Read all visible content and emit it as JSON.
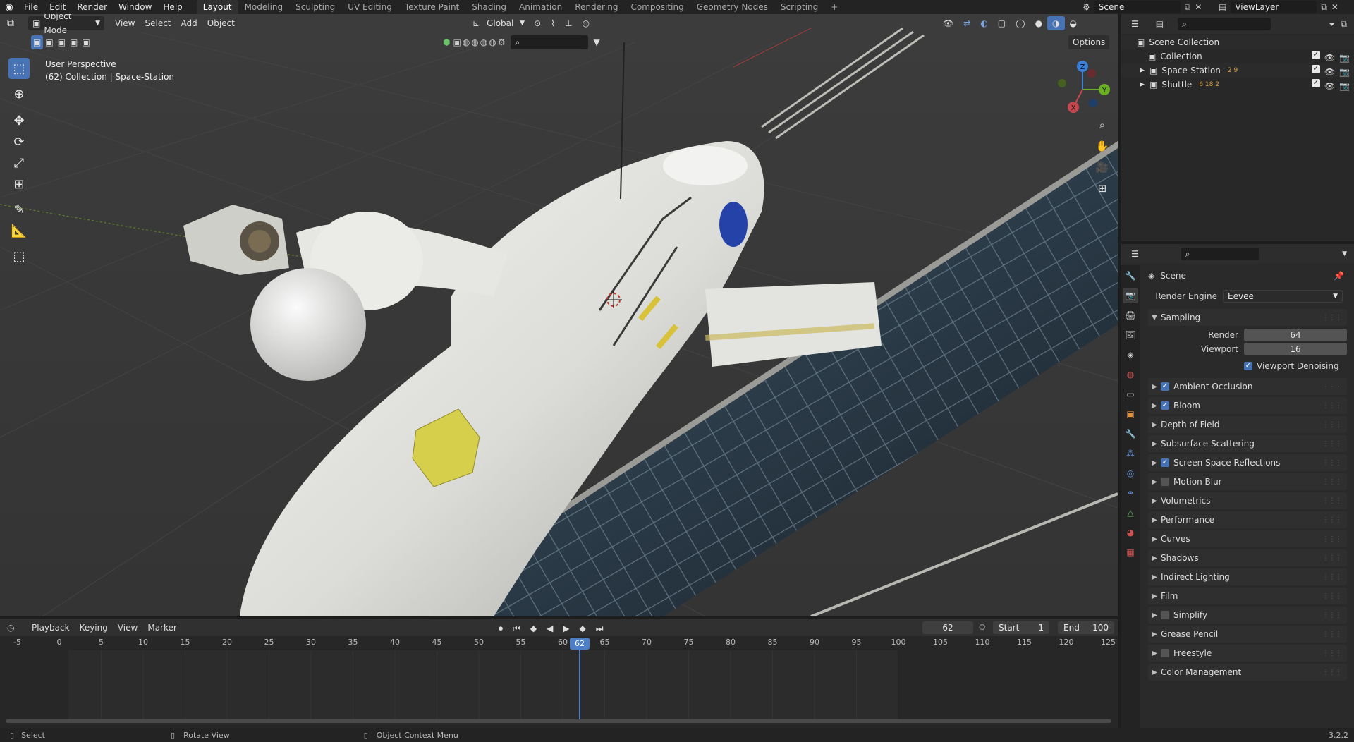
{
  "topbar": {
    "menus": [
      "File",
      "Edit",
      "Render",
      "Window",
      "Help"
    ],
    "workspaces": [
      "Layout",
      "Modeling",
      "Sculpting",
      "UV Editing",
      "Texture Paint",
      "Shading",
      "Animation",
      "Rendering",
      "Compositing",
      "Geometry Nodes",
      "Scripting"
    ],
    "active_workspace": "Layout",
    "add_tab": "+",
    "scene_name": "Scene",
    "view_layer": "ViewLayer"
  },
  "viewport": {
    "mode": "Object Mode",
    "menus": [
      "View",
      "Select",
      "Add",
      "Object"
    ],
    "orientation": "Global",
    "options_label": "Options",
    "overlay_title": "User Perspective",
    "overlay_subtitle": "(62) Collection | Space-Station",
    "gizmo": {
      "x": "X",
      "y": "Y",
      "z": "Z"
    }
  },
  "timeline": {
    "menus": [
      "Playback",
      "Keying",
      "View",
      "Marker"
    ],
    "current_frame": "62",
    "start_label": "Start",
    "start_value": "1",
    "end_label": "End",
    "end_value": "100",
    "ticks": [
      "-5",
      "0",
      "5",
      "10",
      "15",
      "20",
      "25",
      "30",
      "35",
      "40",
      "45",
      "50",
      "55",
      "60",
      "65",
      "70",
      "75",
      "80",
      "85",
      "90",
      "95",
      "100",
      "105",
      "110",
      "115",
      "120",
      "125"
    ],
    "playhead_label": "62"
  },
  "statusbar": {
    "select": "Select",
    "rotate": "Rotate View",
    "context": "Object Context Menu",
    "version": "3.2.2"
  },
  "outliner": {
    "root": "Scene Collection",
    "items": [
      {
        "label": "Collection",
        "badges": ""
      },
      {
        "label": "Space-Station",
        "badges": "2  9"
      },
      {
        "label": "Shuttle",
        "badges": "6  18  2"
      }
    ]
  },
  "properties": {
    "context_title": "Scene",
    "render_engine_label": "Render Engine",
    "render_engine_value": "Eevee",
    "sampling": {
      "title": "Sampling",
      "render_label": "Render",
      "render_value": "64",
      "viewport_label": "Viewport",
      "viewport_value": "16",
      "denoise_label": "Viewport Denoising"
    },
    "panels": [
      {
        "label": "Ambient Occlusion",
        "checkbox": "on"
      },
      {
        "label": "Bloom",
        "checkbox": "on"
      },
      {
        "label": "Depth of Field",
        "checkbox": "none"
      },
      {
        "label": "Subsurface Scattering",
        "checkbox": "none"
      },
      {
        "label": "Screen Space Reflections",
        "checkbox": "on"
      },
      {
        "label": "Motion Blur",
        "checkbox": "off"
      },
      {
        "label": "Volumetrics",
        "checkbox": "none"
      },
      {
        "label": "Performance",
        "checkbox": "none"
      },
      {
        "label": "Curves",
        "checkbox": "none"
      },
      {
        "label": "Shadows",
        "checkbox": "none"
      },
      {
        "label": "Indirect Lighting",
        "checkbox": "none"
      },
      {
        "label": "Film",
        "checkbox": "none"
      },
      {
        "label": "Simplify",
        "checkbox": "off"
      },
      {
        "label": "Grease Pencil",
        "checkbox": "none"
      },
      {
        "label": "Freestyle",
        "checkbox": "off"
      },
      {
        "label": "Color Management",
        "checkbox": "none"
      }
    ]
  },
  "colors": {
    "accent": "#4772b3",
    "playhead": "#4d7fc7",
    "x_axis": "#c8484f",
    "y_axis": "#6ab023",
    "z_axis": "#3b7fd6"
  }
}
